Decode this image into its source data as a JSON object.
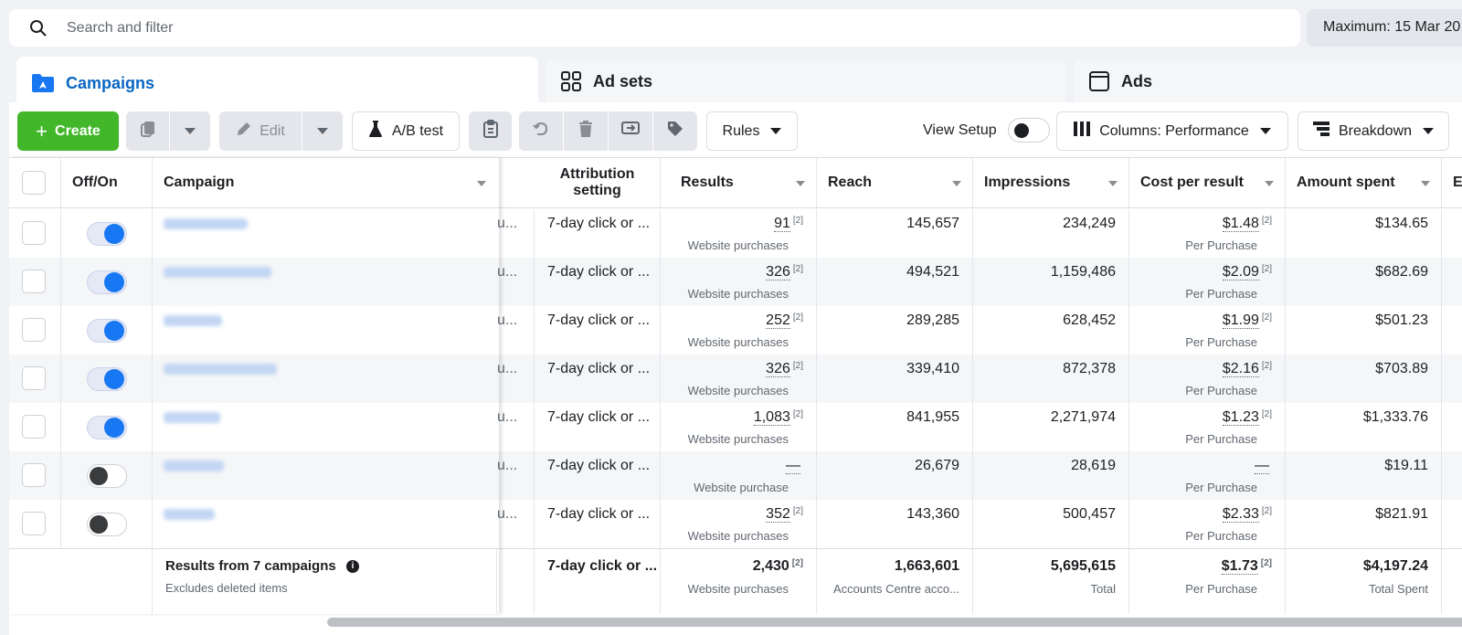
{
  "search": {
    "placeholder": "Search and filter"
  },
  "date_range": "Maximum: 15 Mar 20",
  "tabs": [
    {
      "label": "Campaigns",
      "icon": "folder-icon"
    },
    {
      "label": "Ad sets",
      "icon": "grid-icon"
    },
    {
      "label": "Ads",
      "icon": "ad-frame-icon"
    }
  ],
  "toolbar": {
    "create_label": "Create",
    "edit_label": "Edit",
    "ab_test_label": "A/B test",
    "rules_label": "Rules",
    "view_setup_label": "View Setup",
    "columns_label": "Columns: Performance",
    "breakdown_label": "Breakdown"
  },
  "table": {
    "headers": {
      "onoff": "Off/On",
      "campaign": "Campaign",
      "attribution": "Attribution setting",
      "results": "Results",
      "reach": "Reach",
      "impressions": "Impressions",
      "cost_per_result": "Cost per result",
      "amount_spent": "Amount spent",
      "next": "E"
    },
    "rows": [
      {
        "on": true,
        "trunc": "u...",
        "attribution": "7-day click or ...",
        "results": "91",
        "results_note": "[2]",
        "results_sub": "Website purchases",
        "reach": "145,657",
        "impressions": "234,249",
        "cpr": "$1.48",
        "cpr_note": "[2]",
        "cpr_sub": "Per Purchase",
        "spent": "$134.65"
      },
      {
        "on": true,
        "trunc": "u...",
        "attribution": "7-day click or ...",
        "results": "326",
        "results_note": "[2]",
        "results_sub": "Website purchases",
        "reach": "494,521",
        "impressions": "1,159,486",
        "cpr": "$2.09",
        "cpr_note": "[2]",
        "cpr_sub": "Per Purchase",
        "spent": "$682.69"
      },
      {
        "on": true,
        "trunc": "u...",
        "attribution": "7-day click or ...",
        "results": "252",
        "results_note": "[2]",
        "results_sub": "Website purchases",
        "reach": "289,285",
        "impressions": "628,452",
        "cpr": "$1.99",
        "cpr_note": "[2]",
        "cpr_sub": "Per Purchase",
        "spent": "$501.23"
      },
      {
        "on": true,
        "trunc": "u...",
        "attribution": "7-day click or ...",
        "results": "326",
        "results_note": "[2]",
        "results_sub": "Website purchases",
        "reach": "339,410",
        "impressions": "872,378",
        "cpr": "$2.16",
        "cpr_note": "[2]",
        "cpr_sub": "Per Purchase",
        "spent": "$703.89"
      },
      {
        "on": true,
        "trunc": "u...",
        "attribution": "7-day click or ...",
        "results": "1,083",
        "results_note": "[2]",
        "results_sub": "Website purchases",
        "reach": "841,955",
        "impressions": "2,271,974",
        "cpr": "$1.23",
        "cpr_note": "[2]",
        "cpr_sub": "Per Purchase",
        "spent": "$1,333.76"
      },
      {
        "on": false,
        "trunc": "u...",
        "attribution": "7-day click or ...",
        "results": "—",
        "results_note": "",
        "results_sub": "Website purchase",
        "reach": "26,679",
        "impressions": "28,619",
        "cpr": "—",
        "cpr_note": "",
        "cpr_sub": "Per Purchase",
        "spent": "$19.11"
      },
      {
        "on": false,
        "trunc": "u...",
        "attribution": "7-day click or ...",
        "results": "352",
        "results_note": "[2]",
        "results_sub": "Website purchases",
        "reach": "143,360",
        "impressions": "500,457",
        "cpr": "$2.33",
        "cpr_note": "[2]",
        "cpr_sub": "Per Purchase",
        "spent": "$821.91"
      }
    ],
    "totals": {
      "label": "Results from 7 campaigns",
      "sub": "Excludes deleted items",
      "attribution": "7-day click or ...",
      "results": "2,430",
      "results_note": "[2]",
      "results_sub": "Website purchases",
      "reach": "1,663,601",
      "reach_sub": "Accounts Centre acco...",
      "impressions": "5,695,615",
      "impressions_sub": "Total",
      "cpr": "$1.73",
      "cpr_note": "[2]",
      "cpr_sub": "Per Purchase",
      "spent": "$4,197.24",
      "spent_sub": "Total Spent"
    }
  },
  "colors": {
    "accent": "#0a66c2",
    "create": "#42b72a",
    "toggle_on": "#1877f2"
  }
}
